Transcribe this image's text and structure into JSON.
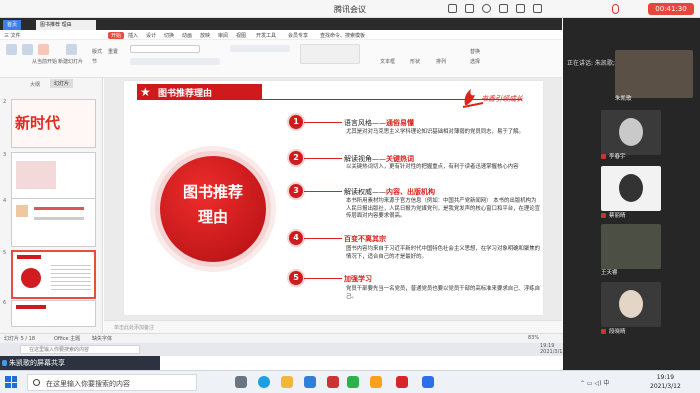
{
  "app": {
    "title": "腾讯会议",
    "timer": "00:41:30"
  },
  "wps": {
    "tab_home": "首页",
    "tab_doc": "图书推荐 理由1.0.pptx",
    "menu": [
      "三 文件",
      "开始",
      "插入",
      "设计",
      "切换",
      "动画",
      "放映",
      "审阅",
      "视图",
      "开发工具",
      "会员专享",
      "查找命令、搜索模板"
    ],
    "menu_active": "开始",
    "ribbon": [
      "从当前开始",
      "新建幻灯片",
      "版式",
      "节",
      "重置",
      "文本框",
      "形状",
      "排列",
      "替换",
      "选择"
    ]
  },
  "left_panel": {
    "tabs": [
      "大纲",
      "幻灯片"
    ],
    "slides": [
      {
        "num": "2",
        "text": "新时代"
      },
      {
        "num": "3",
        "text": ""
      },
      {
        "num": "4",
        "text": ""
      },
      {
        "num": "5",
        "text": ""
      },
      {
        "num": "6",
        "text": ""
      }
    ]
  },
  "slide": {
    "title": "图书推荐理由",
    "logo": "书香引领成长",
    "circle_text": "图书推荐\n理由",
    "items": [
      {
        "num": "1",
        "head": "语言风格——",
        "hi": "通俗易懂",
        "body": "尤其是对对马克思主义学科理论知识基础相对薄弱的党员同志，易于了解。"
      },
      {
        "num": "2",
        "head": "解读视角——",
        "hi": "关键热词",
        "body": "以关键热词切入，更有针对性的把握重点，有利于读者迅速掌握核心内容"
      },
      {
        "num": "3",
        "head": "解读权威——",
        "hi": "内容、出版机构",
        "body": "本书所用素材均来源于官方信息（例如：中国共产党新闻网）  本书的出版机构为人民日报出版社，人民日报为党媒党刊，是我党发声的核心窗口和平台，在理论宣传层面对内容要求很高。"
      },
      {
        "num": "4",
        "head": "",
        "hi": "百变不离其宗",
        "body": "图书内容均来自于习近平新时代中国特色社会主义思想，在学习对象明确和聚焦的情况下，适合自己的才是最好的。"
      },
      {
        "num": "5",
        "head": "",
        "hi": "加强学习",
        "body": "党员干部要先当一名党员，普通党员也要以党员干部的高标准来要求自己、浮练自己。"
      }
    ]
  },
  "notes": {
    "placeholder": "单击此处添加备注"
  },
  "status": {
    "slide": "幻灯片 5 / 18",
    "theme": "Office 主题",
    "missing": "缺失字体",
    "zoom": "83%"
  },
  "inner_taskbar": {
    "search": "在这里输入你要搜索的内容",
    "time": "19:19",
    "date": "2021/3/12"
  },
  "share": {
    "label": "朱凯歌的屏幕共享"
  },
  "taskbar": {
    "search": "在这里输入你要搜索的内容",
    "time": "19:19",
    "date": "2021/3/12"
  },
  "meeting": {
    "speaking": "正在讲话: 朱凯歌;",
    "participants": [
      {
        "name": "朱凯歌"
      },
      {
        "name": "李春宇"
      },
      {
        "name": "蔡丽晴"
      },
      {
        "name": "王天睿"
      },
      {
        "name": "段晓晴"
      }
    ]
  },
  "colors": {
    "brand": "#ce1a1c",
    "accent": "#3d7ee8",
    "meeting_bg": "#262626"
  }
}
